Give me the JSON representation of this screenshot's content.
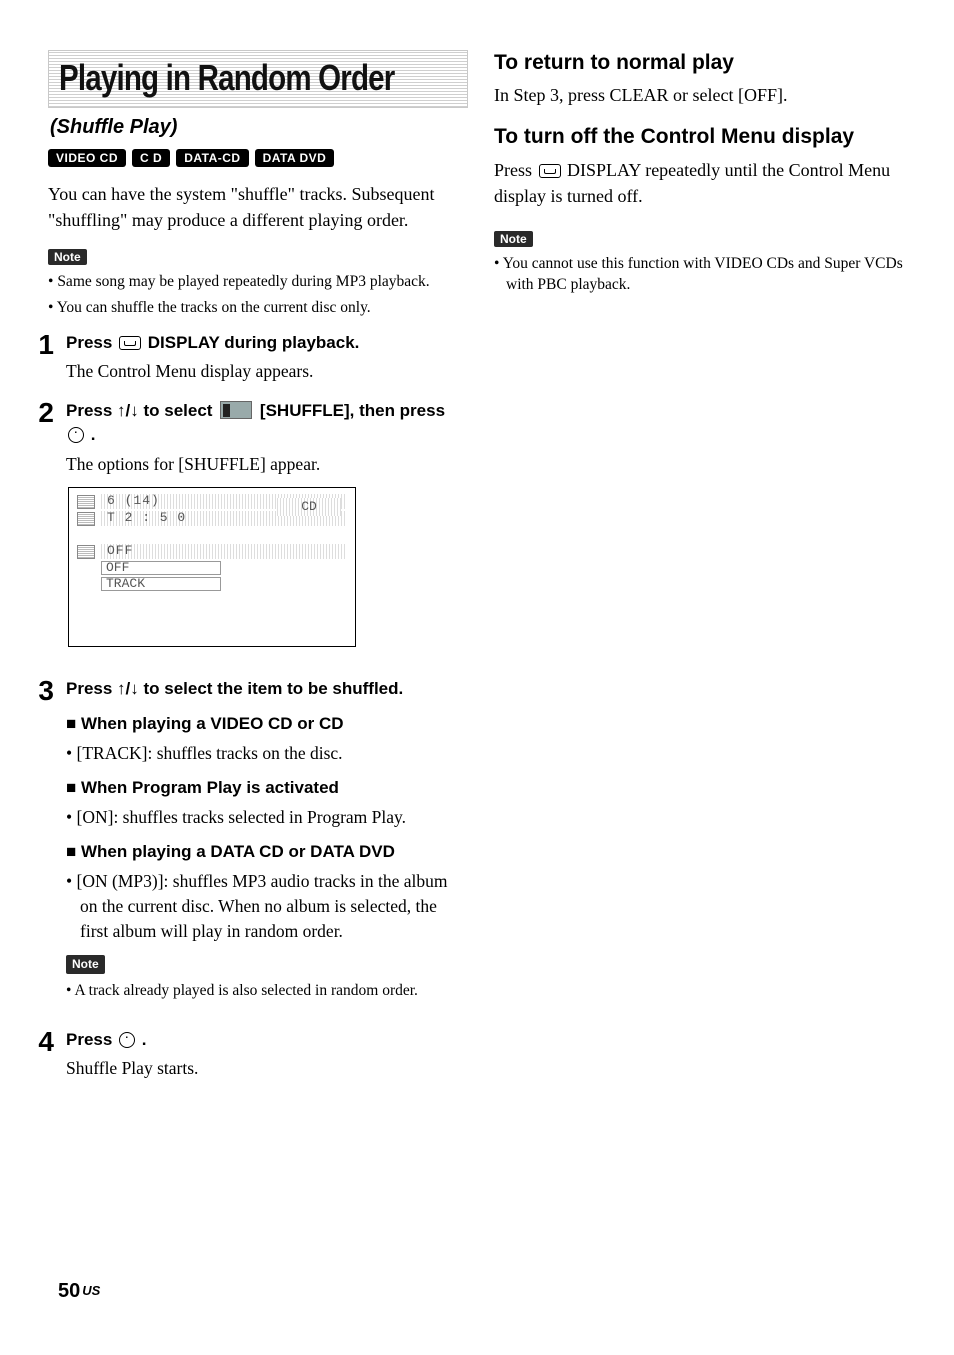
{
  "title": "Playing in Random Order",
  "subtitle": "(Shuffle Play)",
  "tags": [
    "VIDEO CD",
    "C D",
    "DATA-CD",
    "DATA DVD"
  ],
  "intro": "You can have the system \"shuffle\" tracks. Subsequent \"shuffling\" may produce a different playing order.",
  "note1_label": "Note",
  "note1": [
    "Same song may be played repeatedly during MP3 playback.",
    "You can shuffle the tracks on the current disc only."
  ],
  "steps": {
    "s1": {
      "num": "1",
      "head_a": "Press ",
      "head_b": " DISPLAY during playback.",
      "body": "The Control Menu display appears."
    },
    "s2": {
      "num": "2",
      "head_a": "Press ↑/↓ to select ",
      "head_b": " [SHUFFLE], then press ",
      "head_c": " .",
      "body": "The options for [SHUFFLE] appear."
    },
    "s3": {
      "num": "3",
      "head": "Press ↑/↓ to select the item to be shuffled.",
      "g1_title": "When playing a VIDEO CD or CD",
      "g1_item": "[TRACK]: shuffles tracks on the disc.",
      "g2_title": "When Program Play is activated",
      "g2_item": "[ON]: shuffles tracks selected in Program Play.",
      "g3_title": "When playing a DATA CD or DATA DVD",
      "g3_item": "[ON (MP3)]: shuffles MP3 audio tracks in the album on the current disc. When no album is selected, the first album will play in random order.",
      "note_label": "Note",
      "note_item": "A track already played is also selected in random order."
    },
    "s4": {
      "num": "4",
      "head_a": "Press ",
      "head_b": " .",
      "body": "Shuffle Play starts."
    }
  },
  "screen": {
    "line1": "6 (14)",
    "line2": "T     2 : 5 0",
    "disc": "CD",
    "off_hi": "OFF",
    "opt1": "OFF",
    "opt2": "TRACK"
  },
  "right": {
    "h1": "To return to normal play",
    "p1": "In Step 3, press CLEAR or select [OFF].",
    "h2": "To turn off the Control Menu display",
    "p2a": "Press ",
    "p2b": " DISPLAY repeatedly until the Control Menu display is turned off.",
    "note_label": "Note",
    "note_item": "You cannot use this function with VIDEO CDs and Super VCDs with PBC playback."
  },
  "footer": {
    "page": "50",
    "region": "US"
  }
}
